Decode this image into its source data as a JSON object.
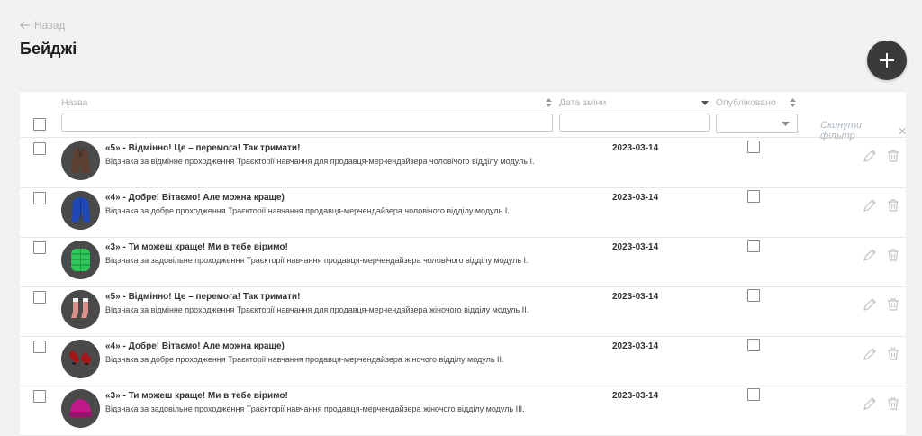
{
  "nav": {
    "back_label": "Назад"
  },
  "page": {
    "title": "Бейджі"
  },
  "table": {
    "columns": [
      {
        "label": "Назва"
      },
      {
        "label": "Дата зміни"
      },
      {
        "label": "Опубліковано"
      }
    ],
    "filters": {
      "name_value": "",
      "date_value": "",
      "published_value": "",
      "reset_label": "Скинути фільтр"
    },
    "rows": [
      {
        "title": "«5» - Відмінно! Це – перемога! Так тримати!",
        "description": "Відзнака за відмінне проходження Траєкторії навчання для продавця-мерчендайзера чоловічого відділу модуль І.",
        "date": "2023-03-14",
        "published": false,
        "image": "coat"
      },
      {
        "title": "«4» - Добре! Вітаємо! Але можна краще)",
        "description": "Відзнака за добре проходження Траєкторії навчання продавця-мерчендайзера чоловічого відділу модуль І.",
        "date": "2023-03-14",
        "published": false,
        "image": "jacket"
      },
      {
        "title": "«3» - Ти можеш краще! Ми в тебе віримо!",
        "description": "Відзнака за задовільне проходження Траєкторії навчання продавця-мерчендайзера чоловічого відділу модуль І.",
        "date": "2023-03-14",
        "published": false,
        "image": "puffer"
      },
      {
        "title": "«5» - Відмінно! Це – перемога! Так тримати!",
        "description": "Відзнака за відмінне проходження Траєкторії навчання для продавця-мерчендайзера жіночого відділу модуль ІІ.",
        "date": "2023-03-14",
        "published": false,
        "image": "socks"
      },
      {
        "title": "«4» - Добре! Вітаємо! Але можна краще)",
        "description": "Відзнака за добре проходження Траєкторії навчання продавця-мерчендайзера жіночого відділу модуль ІІ.",
        "date": "2023-03-14",
        "published": false,
        "image": "shoes"
      },
      {
        "title": "«3» - Ти можеш краще! Ми в тебе віримо!",
        "description": "Відзнака за задовільне проходження Траєкторії навчання продавця-мерчендайзера жіночого відділу модуль ІІІ.",
        "date": "2023-03-14",
        "published": false,
        "image": "hat"
      }
    ]
  },
  "icons": {
    "back": "arrow-left-icon",
    "add": "plus-icon",
    "sort": "sort-icon",
    "sort_desc": "caret-down-icon",
    "select_arrow": "chevron-down-icon",
    "reset": "close-icon",
    "edit": "pencil-icon",
    "delete": "trash-icon"
  },
  "colors": {
    "page_bg": "#f2f2f2",
    "table_bg": "#ffffff",
    "add_button": "#3a3a3a",
    "muted_text": "#b5b5b5",
    "action_icon": "#c4c4c4",
    "avatar_bg": "#4a4a4a"
  }
}
